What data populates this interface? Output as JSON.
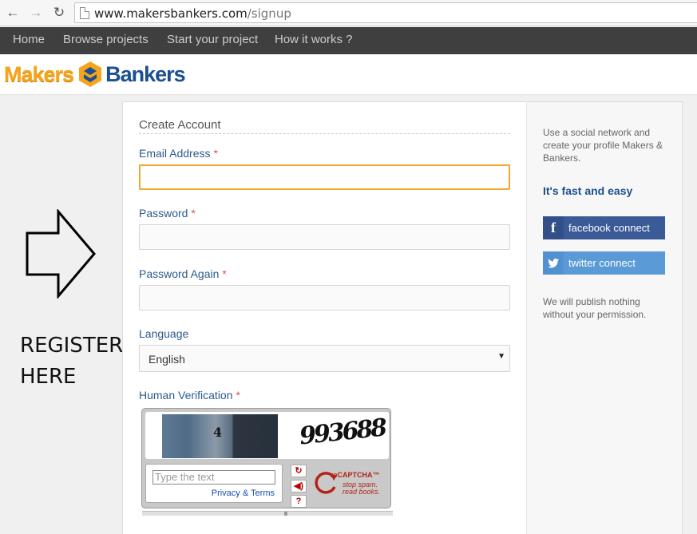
{
  "browser": {
    "url_host": "www.makersbankers.com",
    "url_path": "/signup",
    "back_icon": "arrow-left-icon",
    "forward_icon": "arrow-right-icon",
    "reload_icon": "reload-icon"
  },
  "nav": {
    "items": [
      "Home",
      "Browse projects",
      "Start your project",
      "How it works ?"
    ]
  },
  "logo": {
    "makers": "Makers",
    "bankers": "Bankers",
    "colors": {
      "makers": "#f5a51c",
      "bankers": "#1c4f8e"
    }
  },
  "annotation": {
    "line1": "REGISTER",
    "line2": "HERE"
  },
  "form": {
    "title": "Create Account",
    "required_mark": "*",
    "email_label": "Email Address",
    "password_label": "Password",
    "password_again_label": "Password Again",
    "language_label": "Language",
    "language_value": "English",
    "verification_label": "Human Verification"
  },
  "captcha": {
    "photo_text": "4",
    "word_text": "993688",
    "input_placeholder": "Type the text",
    "privacy": "Privacy & Terms",
    "brand": "reCAPTCHA™",
    "tagline1": "stop spam.",
    "tagline2": "read books.",
    "buttons": [
      "refresh-icon",
      "audio-icon",
      "help-icon"
    ]
  },
  "sidebar": {
    "intro": "Use a social network and create your profile Makers & Bankers.",
    "fast_easy": "It's fast and easy",
    "facebook_label": "facebook connect",
    "twitter_label": "twitter connect",
    "note": "We will publish nothing without your permission."
  }
}
